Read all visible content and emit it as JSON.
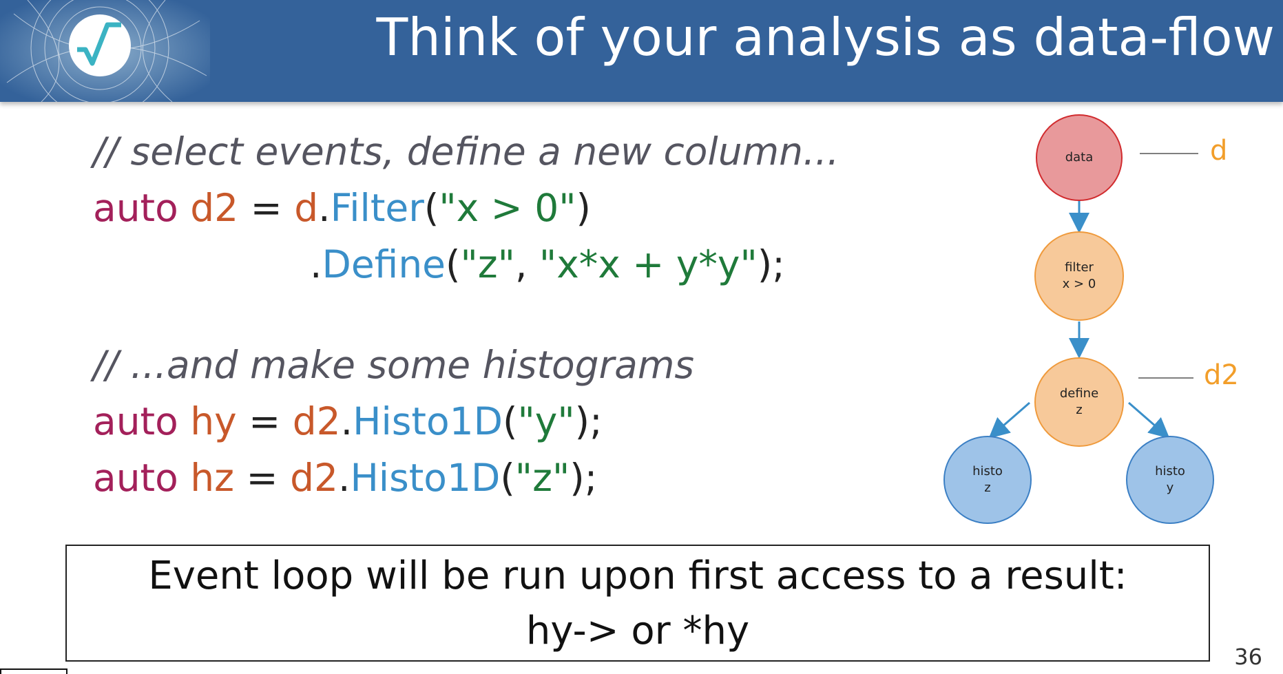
{
  "header": {
    "title": "Think of your analysis as data-flow",
    "background": "#34629a"
  },
  "code": {
    "line1_comment": "// select events, define a new column...",
    "line2": {
      "kw": "auto",
      "var": "d2",
      "eq": " = ",
      "obj": "d",
      "dot": ".",
      "fn": "Filter",
      "open": "(",
      "str": "\"x > 0\"",
      "close": ")"
    },
    "line3": {
      "dot": ".",
      "fn": "Define",
      "open": "(",
      "str1": "\"z\"",
      "comma": ", ",
      "str2": "\"x*x + y*y\"",
      "close": ");"
    },
    "line4_comment": "// ...and make some histograms",
    "line5": {
      "kw": "auto",
      "var": "hy",
      "eq": " = ",
      "obj": "d2",
      "dot": ".",
      "fn": "Histo1D",
      "open": "(",
      "str": "\"y\"",
      "close": ");"
    },
    "line6": {
      "kw": "auto",
      "var": "hz",
      "eq": " = ",
      "obj": "d2",
      "dot": ".",
      "fn": "Histo1D",
      "open": "(",
      "str": "\"z\"",
      "close": ");"
    }
  },
  "diagram": {
    "nodes": {
      "data": {
        "line1": "data",
        "line2": ""
      },
      "filter": {
        "line1": "filter",
        "line2": "x > 0"
      },
      "define": {
        "line1": "define",
        "line2": "z"
      },
      "histo_z": {
        "line1": "histo",
        "line2": "z"
      },
      "histo_y": {
        "line1": "histo",
        "line2": "y"
      }
    },
    "labels": {
      "d": "d",
      "d2": "d2"
    },
    "colors": {
      "data": "#e8999b",
      "data_border": "#d12b2e",
      "process": "#f7c99a",
      "process_border": "#ef9a3c",
      "histo": "#9ec3e8",
      "histo_border": "#3b7fc4",
      "arrow": "#3a8fc9",
      "label": "#f29e2a"
    }
  },
  "box": {
    "line1": "Event loop will be run upon first access to a result:",
    "line2": "hy-> or *hy"
  },
  "page_number": "36"
}
